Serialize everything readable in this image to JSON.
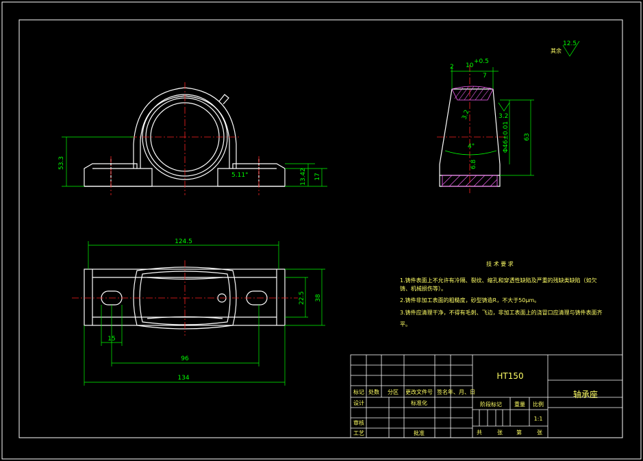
{
  "front_view": {
    "dim_height_left": "53.3",
    "dim_height_base": "13.42",
    "dim_height_foot": "17",
    "dim_angle": "5.11°"
  },
  "side_view": {
    "dim_top_2": "2",
    "dim_top_10": "10",
    "dim_top_tol": "+0.5",
    "dim_top_7": "7",
    "dim_bore": "Φ46±0.01",
    "dim_height": "63",
    "dim_angle": "4°",
    "dim_web": "6.8",
    "roughness_mark": "3.2",
    "roughness_small": "3.2"
  },
  "top_view": {
    "dim_overall_top": "124.5",
    "dim_overall_bottom": "134",
    "dim_hole_spacing": "96",
    "dim_slot": "15",
    "dim_width_inner": "22.5",
    "dim_width_outer": "38"
  },
  "roughness_note": {
    "label": "其余",
    "value": "12.5"
  },
  "tech_requirements": {
    "title": "技 术 要 求",
    "items": [
      "1.铸件表面上不允许有冷隔、裂纹、缩孔和穿透性缺陷及严重的残缺类缺陷（如欠",
      "铸、机械损伤等）。",
      "2.铸件非加工表面的粗糙度，砂型铸造R，不大于50μm。",
      "3.铸件应清理干净，不得有毛刺、飞边，非加工表面上的浇冒口应清理与铸件表面齐",
      "平。"
    ]
  },
  "title_block": {
    "material": "HT150",
    "part_name": "轴承座",
    "row_labels": [
      "标记",
      "处数",
      "分区",
      "更改文件号",
      "签名",
      "年、月、日"
    ],
    "design": "设计",
    "standardize": "标准化",
    "stage_mark": "阶段标记",
    "weight": "重量",
    "scale_label": "比例",
    "scale": "1:1",
    "review": "审核",
    "process": "工艺",
    "approve": "批准",
    "total": "共",
    "sheets": "张",
    "sheet_no": "第",
    "sheet_unit": "张"
  }
}
